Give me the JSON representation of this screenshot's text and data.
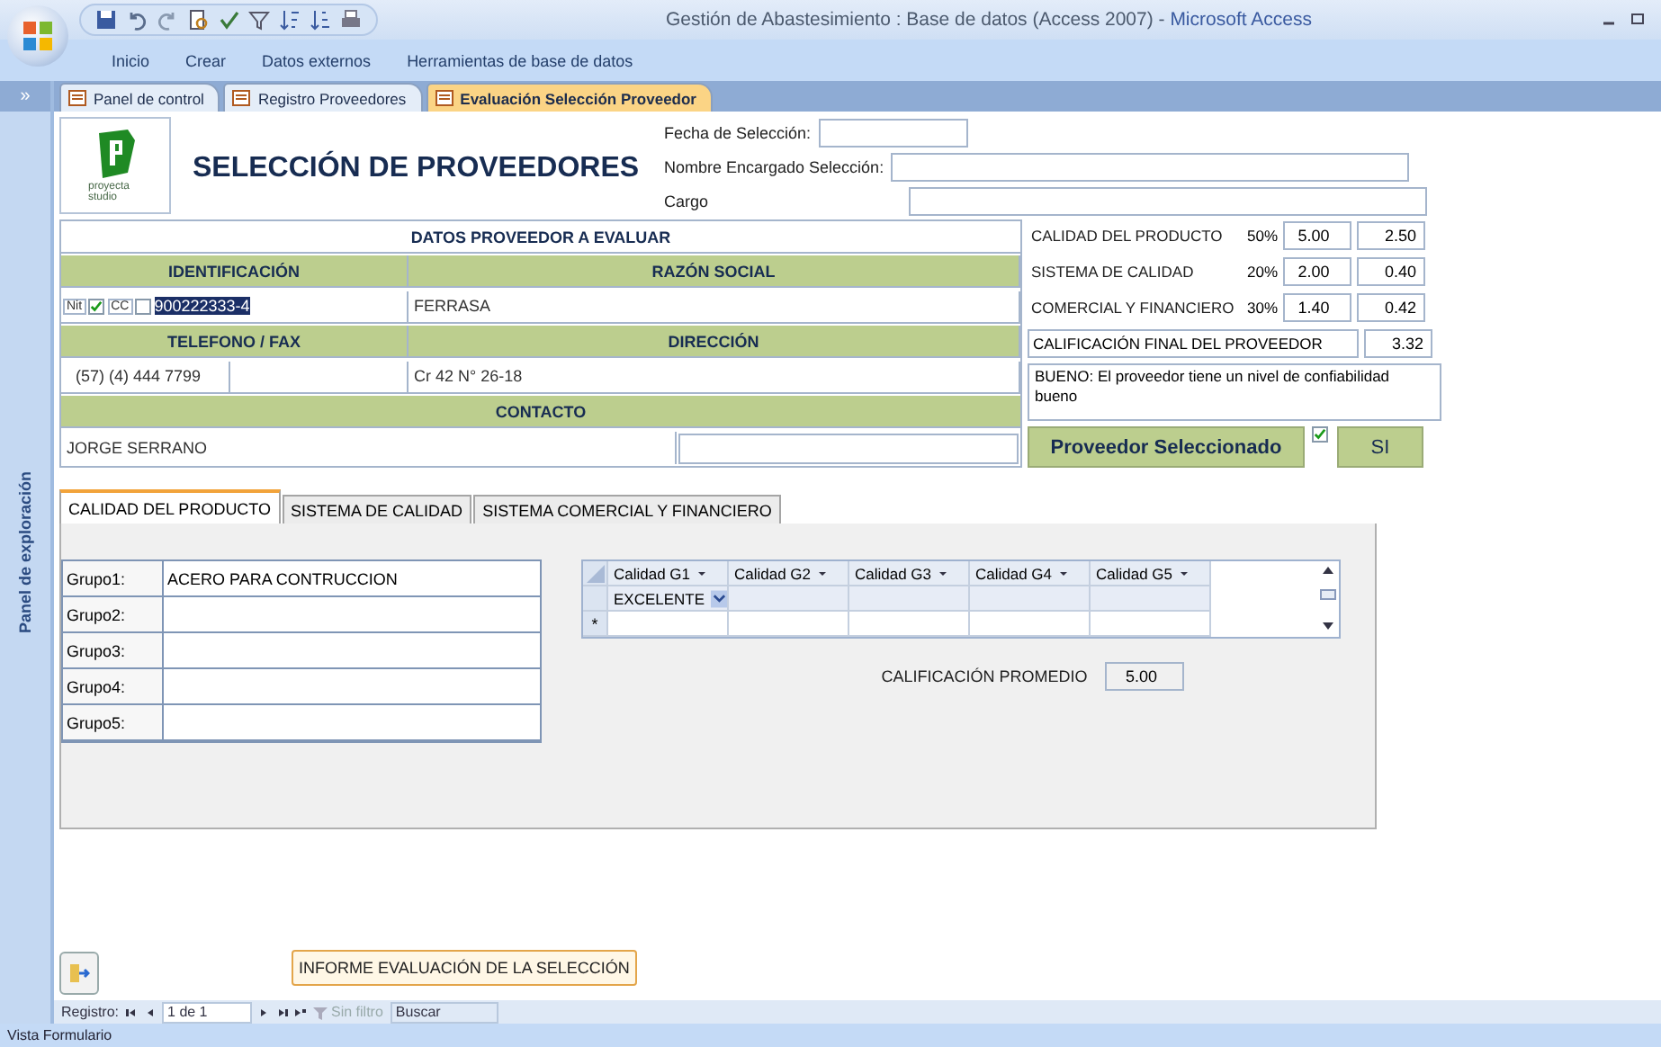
{
  "window": {
    "title": "Gestión de Abastesimiento : Base de datos (Access 2007)",
    "separator": "-",
    "app": "Microsoft Access"
  },
  "ribbon_tabs": [
    "Inicio",
    "Crear",
    "Datos externos",
    "Herramientas de base de datos"
  ],
  "nav_pane": {
    "toggle": "»",
    "title": "Panel de exploración"
  },
  "doc_tabs": [
    {
      "label": "Panel de control",
      "selected": false
    },
    {
      "label": "Registro Proveedores",
      "selected": false
    },
    {
      "label": "Evaluación Selección Proveedor",
      "selected": true
    }
  ],
  "header": {
    "logo_text": "proyecta studio",
    "title": "SELECCIÓN DE PROVEEDORES",
    "fields": [
      {
        "label": "Fecha de Selección:"
      },
      {
        "label": "Nombre Encargado Selección:"
      },
      {
        "label": "Cargo"
      }
    ]
  },
  "provider": {
    "heading": "DATOS PROVEEDOR A EVALUAR",
    "id_heading": "IDENTIFICACIÓN",
    "name_heading": "RAZÓN SOCIAL",
    "id_types": [
      {
        "label": "Nit",
        "checked": true
      },
      {
        "label": "CC",
        "checked": false
      }
    ],
    "id_value": "900222333-4",
    "name_value": "FERRASA",
    "phone_heading": "TELEFONO / FAX",
    "address_heading": "DIRECCIÓN",
    "phone": "(57) (4) 444 7799",
    "address": "Cr 42 N° 26-18",
    "contact_heading": "CONTACTO",
    "contact": "JORGE SERRANO"
  },
  "scores": {
    "rows": [
      {
        "label": "CALIDAD DEL PRODUCTO",
        "weight": "50%",
        "score": "5.00",
        "weighted": "2.50"
      },
      {
        "label": "SISTEMA DE CALIDAD",
        "weight": "20%",
        "score": "2.00",
        "weighted": "0.40"
      },
      {
        "label": "COMERCIAL Y FINANCIERO",
        "weight": "30%",
        "score": "1.40",
        "weighted": "0.42"
      }
    ],
    "final_label": "CALIFICACIÓN FINAL DEL PROVEEDOR",
    "final_value": "3.32",
    "comment": "BUENO:  El proveedor tiene un nivel de confiabilidad bueno",
    "selected_label": "Proveedor Seleccionado",
    "selected_checked": true,
    "selected_value": "SI"
  },
  "subform": {
    "tabs": [
      {
        "label": "CALIDAD DEL PRODUCTO",
        "selected": true
      },
      {
        "label": "SISTEMA DE CALIDAD",
        "selected": false
      },
      {
        "label": "SISTEMA COMERCIAL Y FINANCIERO",
        "selected": false
      }
    ],
    "groups": [
      {
        "label": "Grupo1:",
        "value": "ACERO PARA CONTRUCCION"
      },
      {
        "label": "Grupo2:"
      },
      {
        "label": "Grupo3:"
      },
      {
        "label": "Grupo4:"
      },
      {
        "label": "Grupo5:"
      }
    ],
    "grid": {
      "columns": [
        "Calidad G1",
        "Calidad G2",
        "Calidad G3",
        "Calidad G4",
        "Calidad G5"
      ],
      "rows": [
        [
          "EXCELENTE"
        ]
      ],
      "new_row_marker": "*"
    },
    "average_label": "CALIFICACIÓN PROMEDIO",
    "average_value": "5.00"
  },
  "report_button": "INFORME EVALUACIÓN DE LA SELECCIÓN",
  "record_nav": {
    "label": "Registro:",
    "position": "1 de 1",
    "filter": "Sin filtro",
    "search": "Buscar"
  },
  "status_bar": "Vista Formulario"
}
